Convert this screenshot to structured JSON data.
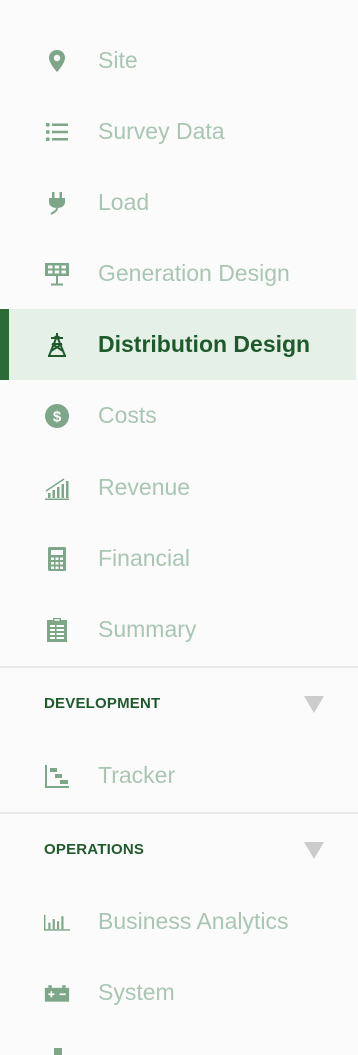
{
  "colors": {
    "accent": "#2a6b38",
    "inactive_text": "#a9c6b2",
    "inactive_icon": "#7ea78a",
    "active_bg": "#e5f0e7",
    "section_title": "#1f5a2c"
  },
  "nav": {
    "items": [
      {
        "label": "Site",
        "icon": "map-marker-icon"
      },
      {
        "label": "Survey Data",
        "icon": "list-icon"
      },
      {
        "label": "Load",
        "icon": "plug-icon"
      },
      {
        "label": "Generation Design",
        "icon": "solar-panel-icon"
      },
      {
        "label": "Distribution Design",
        "icon": "transmission-tower-icon",
        "active": true
      },
      {
        "label": "Costs",
        "icon": "dollar-circle-icon"
      },
      {
        "label": "Revenue",
        "icon": "bar-chart-rising-icon"
      },
      {
        "label": "Financial",
        "icon": "calculator-icon"
      },
      {
        "label": "Summary",
        "icon": "clipboard-icon"
      }
    ]
  },
  "development": {
    "title": "DEVELOPMENT",
    "items": [
      {
        "label": "Tracker",
        "icon": "gantt-chart-icon"
      }
    ]
  },
  "operations": {
    "title": "OPERATIONS",
    "items": [
      {
        "label": "Business Analytics",
        "icon": "analytics-chart-icon"
      },
      {
        "label": "System",
        "icon": "battery-icon"
      }
    ]
  }
}
